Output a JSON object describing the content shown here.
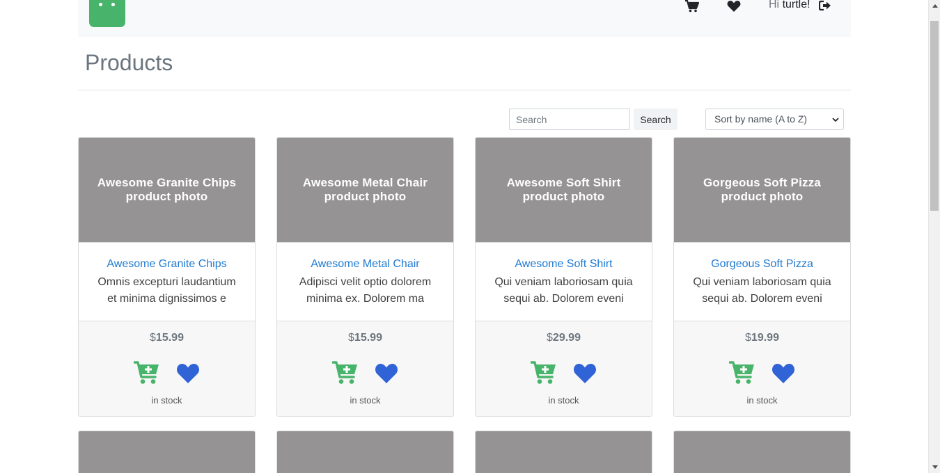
{
  "nav": {
    "greeting_prefix": "Hi",
    "username": "turtle!",
    "icons": [
      "shopping-cart-icon",
      "heart-icon",
      "logout-icon"
    ]
  },
  "page": {
    "title": "Products"
  },
  "toolbar": {
    "search_placeholder": "Search",
    "search_button": "Search",
    "sort_selected": "Sort by name (A to Z)"
  },
  "products": [
    {
      "photo": "Awesome Granite Chips product photo",
      "name": "Awesome Granite Chips",
      "description": "Omnis excepturi laudantium et minima dignissimos e",
      "currency": "$",
      "price": "15.99",
      "stock": "in stock"
    },
    {
      "photo": "Awesome Metal Chair product photo",
      "name": "Awesome Metal Chair",
      "description": "Adipisci velit optio dolorem minima ex. Dolorem ma",
      "currency": "$",
      "price": "15.99",
      "stock": "in stock"
    },
    {
      "photo": "Awesome Soft Shirt product photo",
      "name": "Awesome Soft Shirt",
      "description": "Qui veniam laboriosam quia sequi ab. Dolorem eveni",
      "currency": "$",
      "price": "29.99",
      "stock": "in stock"
    },
    {
      "photo": "Gorgeous Soft Pizza product photo",
      "name": "Gorgeous Soft Pizza",
      "description": "Qui veniam laboriosam quia sequi ab. Dolorem eveni",
      "currency": "$",
      "price": "19.99",
      "stock": "in stock"
    }
  ],
  "colors": {
    "brand": "#48b46b",
    "link": "#1f7ad1",
    "cart_icon": "#48b46b",
    "heart_icon": "#2f63d6",
    "photo_placeholder": "#959393"
  }
}
